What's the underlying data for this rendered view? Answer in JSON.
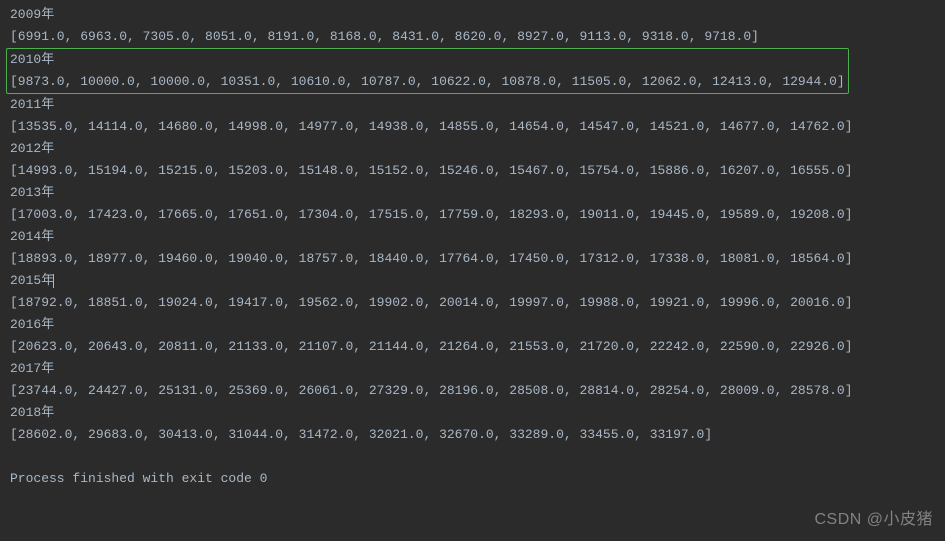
{
  "output": {
    "entries": [
      {
        "year": "2009年",
        "values": "[6991.0, 6963.0, 7305.0, 8051.0, 8191.0, 8168.0, 8431.0, 8620.0, 8927.0, 9113.0, 9318.0, 9718.0]",
        "highlighted": false,
        "cursor": false
      },
      {
        "year": "2010年",
        "values": "[9873.0, 10000.0, 10000.0, 10351.0, 10610.0, 10787.0, 10622.0, 10878.0, 11505.0, 12062.0, 12413.0, 12944.0]",
        "highlighted": true,
        "cursor": false
      },
      {
        "year": "2011年",
        "values": "[13535.0, 14114.0, 14680.0, 14998.0, 14977.0, 14938.0, 14855.0, 14654.0, 14547.0, 14521.0, 14677.0, 14762.0]",
        "highlighted": false,
        "cursor": false
      },
      {
        "year": "2012年",
        "values": "[14993.0, 15194.0, 15215.0, 15203.0, 15148.0, 15152.0, 15246.0, 15467.0, 15754.0, 15886.0, 16207.0, 16555.0]",
        "highlighted": false,
        "cursor": false
      },
      {
        "year": "2013年",
        "values": "[17003.0, 17423.0, 17665.0, 17651.0, 17304.0, 17515.0, 17759.0, 18293.0, 19011.0, 19445.0, 19589.0, 19208.0]",
        "highlighted": false,
        "cursor": false
      },
      {
        "year": "2014年",
        "values": "[18893.0, 18977.0, 19460.0, 19040.0, 18757.0, 18440.0, 17764.0, 17450.0, 17312.0, 17338.0, 18081.0, 18564.0]",
        "highlighted": false,
        "cursor": false
      },
      {
        "year": "2015年",
        "values": "[18792.0, 18851.0, 19024.0, 19417.0, 19562.0, 19902.0, 20014.0, 19997.0, 19988.0, 19921.0, 19996.0, 20016.0]",
        "highlighted": false,
        "cursor": true
      },
      {
        "year": "2016年",
        "values": "[20623.0, 20643.0, 20811.0, 21133.0, 21107.0, 21144.0, 21264.0, 21553.0, 21720.0, 22242.0, 22590.0, 22926.0]",
        "highlighted": false,
        "cursor": false
      },
      {
        "year": "2017年",
        "values": "[23744.0, 24427.0, 25131.0, 25369.0, 26061.0, 27329.0, 28196.0, 28508.0, 28814.0, 28254.0, 28009.0, 28578.0]",
        "highlighted": false,
        "cursor": false
      },
      {
        "year": "2018年",
        "values": "[28602.0, 29683.0, 30413.0, 31044.0, 31472.0, 32021.0, 32670.0, 33289.0, 33455.0, 33197.0]",
        "highlighted": false,
        "cursor": false
      }
    ],
    "exit_message": "Process finished with exit code 0"
  },
  "watermark": "CSDN @小皮猪"
}
